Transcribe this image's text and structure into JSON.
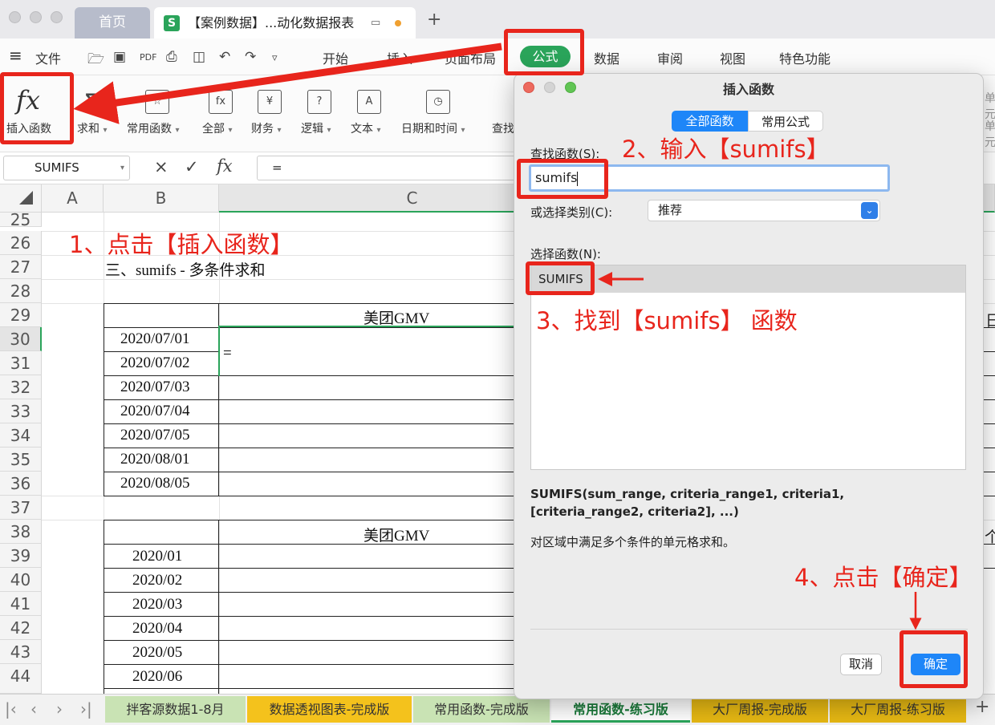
{
  "window": {
    "home_tab": "首页",
    "doc_tab": "【案例数据】...动化数据报表",
    "doc_logo": "S",
    "add_tab": "+"
  },
  "menu": {
    "hamburger": "≡",
    "file": "文件",
    "items": [
      "开始",
      "插入",
      "页面布局",
      "公式",
      "数据",
      "审阅",
      "视图",
      "特色功能"
    ],
    "active": "公式"
  },
  "ribbon": {
    "insert_function": "插入函数",
    "fx_symbol": "fx",
    "buttons": [
      "求和",
      "常用函数",
      "全部",
      "财务",
      "逻辑",
      "文本",
      "日期和时间",
      "查找"
    ],
    "dropdown_caret": "▾"
  },
  "formula_bar": {
    "name_box": "SUMIFS",
    "cancel": "×",
    "confirm": "✓",
    "fx": "fx",
    "content": "="
  },
  "grid": {
    "columns": [
      "A",
      "B",
      "C"
    ],
    "rows": [
      "25",
      "26",
      "27",
      "28",
      "29",
      "30",
      "31",
      "32",
      "33",
      "34",
      "35",
      "36",
      "37",
      "38",
      "39",
      "40",
      "41",
      "42",
      "43",
      "44"
    ],
    "section_title": "三、sumifs - 多条件求和",
    "table1_header": "美团GMV",
    "table1_dates": [
      "2020/07/01",
      "2020/07/02",
      "2020/07/03",
      "2020/07/04",
      "2020/07/05",
      "2020/08/01",
      "2020/08/05"
    ],
    "active_cell_value": "=",
    "table2_header": "美团GMV",
    "table2_months": [
      "2020/01",
      "2020/02",
      "2020/03",
      "2020/04",
      "2020/05",
      "2020/06"
    ],
    "right_edge_fragments": [
      "单元",
      "单元",
      "日",
      "个"
    ]
  },
  "sheet_tabs": [
    "拌客源数据1-8月",
    "数据透视图表-完成版",
    "常用函数-完成版",
    "常用函数-练习版",
    "大厂周报-完成版",
    "大厂周报-练习版"
  ],
  "sheet_tab_colors": [
    "#c9e3b4",
    "#f4c21c",
    "#c9e3b4",
    "#ffffff",
    "#e6b813",
    "#e6b813"
  ],
  "active_sheet": "常用函数-练习版",
  "dialog": {
    "title": "插入函数",
    "segments": [
      "全部函数",
      "常用公式"
    ],
    "search_label": "查找函数(S):",
    "search_value": "sumifs",
    "category_label": "或选择类别(C):",
    "category_value": "推荐",
    "select_label": "选择函数(N):",
    "functions": [
      "SUMIFS"
    ],
    "signature_line1": "SUMIFS(sum_range, criteria_range1, criteria1,",
    "signature_line2": "[criteria_range2, criteria2], ...)",
    "description": "对区域中满足多个条件的单元格求和。",
    "cancel": "取消",
    "ok": "确定"
  },
  "annotations": {
    "step1": "1、点击【插入函数】",
    "step2": "2、输入【sumifs】",
    "step3": "3、找到【sumifs】 函数",
    "step4": "4、点击【确定】"
  },
  "colors": {
    "accent_green": "#2aa45a",
    "annotation_red": "#e8251c",
    "ok_blue": "#1e86f8"
  }
}
